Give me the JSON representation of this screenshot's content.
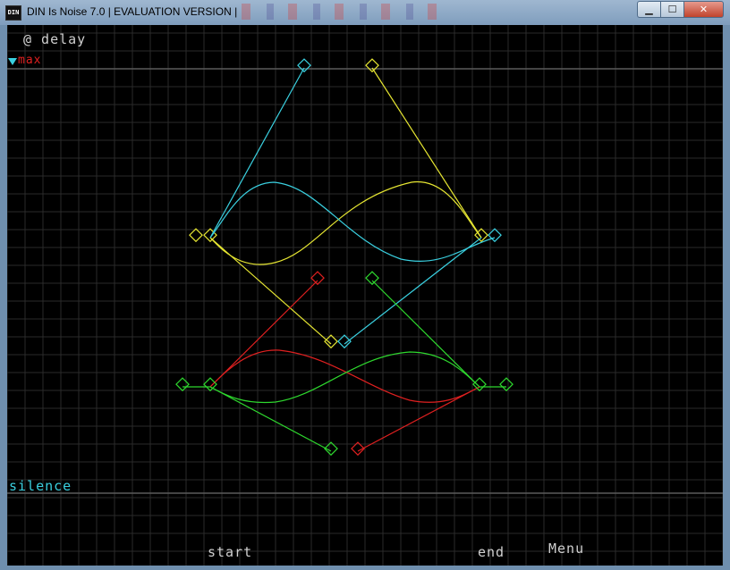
{
  "window": {
    "title": "DIN Is Noise 7.0 | EVALUATION VERSION |",
    "icon_label": "DIN",
    "buttons": {
      "minimize": "▁",
      "maximize": "☐",
      "close": "✕"
    }
  },
  "overlay": {
    "delay_label": "@ delay",
    "max_label": "max",
    "silence_label": "silence",
    "start_label": "start",
    "end_label": "end",
    "menu_label": "Menu"
  },
  "colors": {
    "background": "#000000",
    "grid": "#2a2a2a",
    "guide": "#5a5a5a",
    "yellow": "#e6e632",
    "cyan": "#3ad0e0",
    "red": "#e02020",
    "green": "#2ed82e",
    "text_light": "#d0d0d0",
    "text_cyan": "#3ad0e0",
    "text_red": "#e02020"
  }
}
